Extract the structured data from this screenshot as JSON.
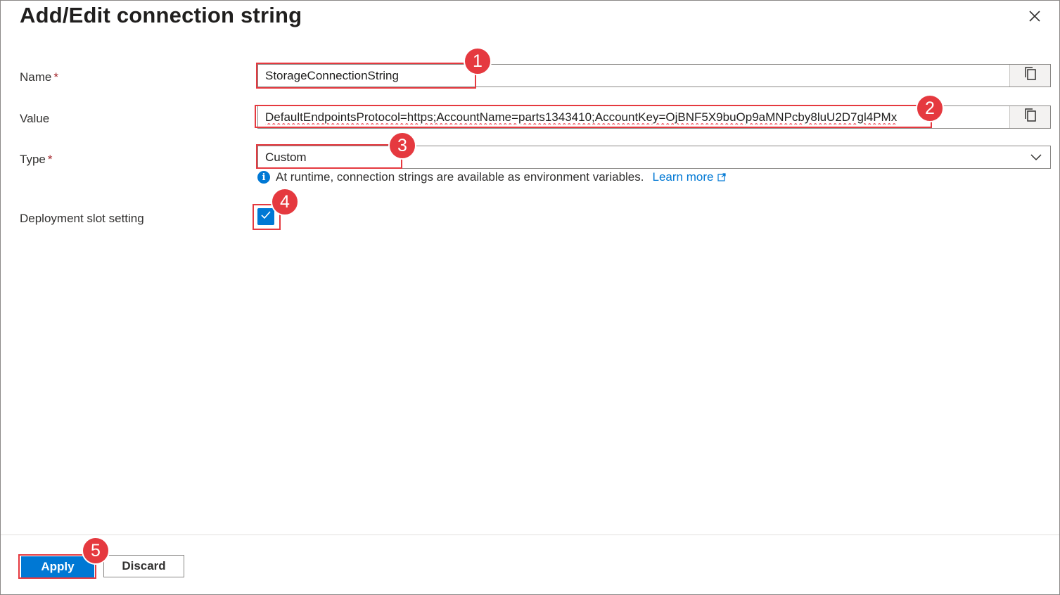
{
  "dialog": {
    "title": "Add/Edit connection string"
  },
  "form": {
    "name": {
      "label": "Name",
      "required_mark": "*",
      "value": "StorageConnectionString"
    },
    "value": {
      "label": "Value",
      "value": "DefaultEndpointsProtocol=https;AccountName=parts1343410;AccountKey=OjBNF5X9buOp9aMNPcby8luU2D7gl4PMx"
    },
    "type": {
      "label": "Type",
      "required_mark": "*",
      "selected": "Custom"
    },
    "info": {
      "text": "At runtime, connection strings are available as environment variables.",
      "link": "Learn more"
    },
    "slot": {
      "label": "Deployment slot setting",
      "checked": true
    }
  },
  "footer": {
    "apply_label": "Apply",
    "discard_label": "Discard"
  },
  "annotations": [
    "1",
    "2",
    "3",
    "4",
    "5"
  ],
  "colors": {
    "accent": "#0078d4",
    "highlight": "#e5393f",
    "required": "#a4262c"
  },
  "icons": [
    "close-icon",
    "copy-icon",
    "chevron-down-icon",
    "info-icon",
    "external-link-icon",
    "checkmark-icon"
  ]
}
